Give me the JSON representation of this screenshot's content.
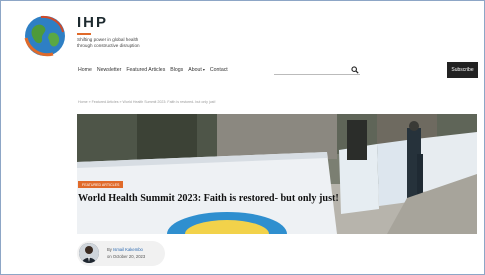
{
  "site": {
    "name": "IHP",
    "tagline_line1": "Shifting power in global health",
    "tagline_line2": "through constructive disruption"
  },
  "nav": {
    "items": [
      "Home",
      "Newsletter",
      "Featured Articles",
      "Blogs",
      "About",
      "Contact"
    ],
    "about_has_dropdown": true,
    "search_icon": "search-icon",
    "subscribe_label": "Subscribe"
  },
  "breadcrumb": "Home » Featured Articles » World Health Summit 2023: Faith is restored- but only just!",
  "article": {
    "category_tag": "FEATURED ARTICLES",
    "title": "World Health Summit 2023: Faith is restored- but only just!",
    "by_prefix": "By",
    "author": "Ismail Kakembo",
    "date": "on October 20, 2023"
  },
  "colors": {
    "accent": "#e06a2a",
    "dark": "#222222",
    "link": "#2b69b0"
  }
}
